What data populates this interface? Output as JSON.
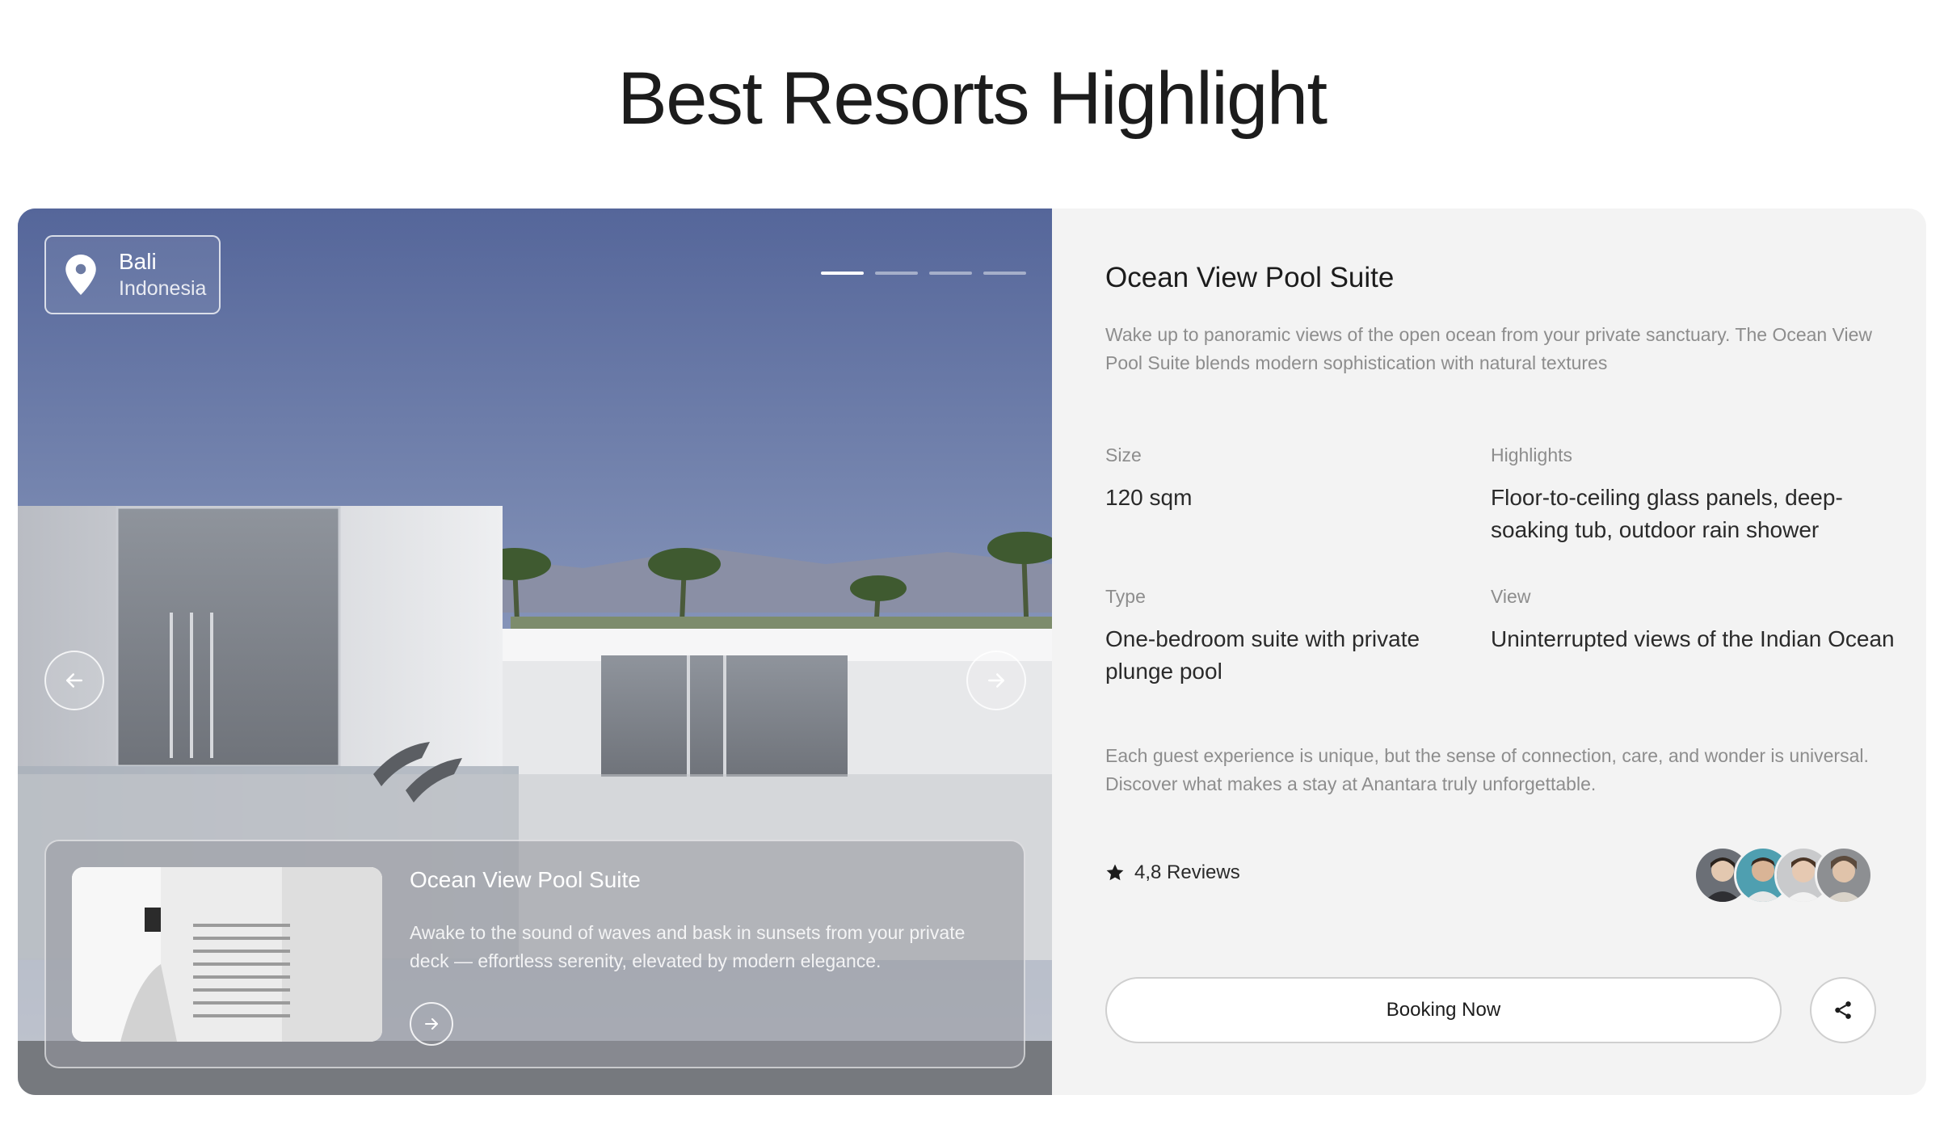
{
  "header": {
    "title": "Best Resorts Highlight"
  },
  "location": {
    "city": "Bali",
    "country": "Indonesia"
  },
  "carousel": {
    "total_slides": 4,
    "active_index": 0
  },
  "featured": {
    "title": "Ocean View Pool Suite",
    "description": "Awake to the sound of waves and bask in sunsets from your private deck — effortless serenity, elevated by modern elegance."
  },
  "details": {
    "title": "Ocean View Pool Suite",
    "description": "Wake up to panoramic views of the open ocean from your private sanctuary. The Ocean View Pool Suite blends modern sophistication with natural textures",
    "specs": {
      "size": {
        "label": "Size",
        "value": "120 sqm"
      },
      "highlights": {
        "label": "Highlights",
        "value": "Floor-to-ceiling glass panels, deep-soaking tub, outdoor rain shower"
      },
      "type": {
        "label": "Type",
        "value": "One-bedroom suite with private plunge pool"
      },
      "view": {
        "label": "View",
        "value": "Uninterrupted views of the Indian Ocean"
      }
    },
    "note": "Each guest experience is unique, but the sense of connection, care, and wonder is universal. Discover what makes a stay at Anantara truly unforgettable.",
    "rating_text": "4,8 Reviews",
    "avatar_count": 4,
    "booking_label": "Booking Now"
  },
  "colors": {
    "panel_bg": "#f3f3f3",
    "text_primary": "#1c1c1c",
    "text_muted": "#8d8d8d",
    "sky": "#5a6a98"
  },
  "icons": {
    "location": "map-pin-icon",
    "prev": "arrow-left-icon",
    "next": "arrow-right-icon",
    "card_arrow": "arrow-right-icon",
    "star": "star-icon",
    "share": "share-icon"
  }
}
